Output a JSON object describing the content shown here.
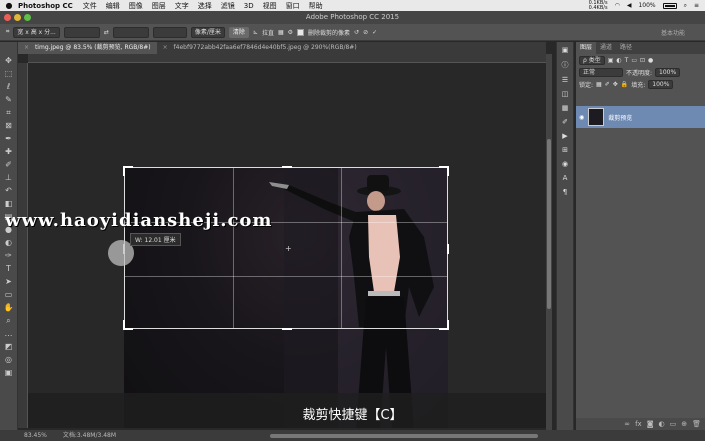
{
  "menubar": {
    "apple": "",
    "app_name": "Photoshop CC",
    "items": [
      "文件",
      "编辑",
      "图像",
      "图层",
      "文字",
      "选择",
      "滤镜",
      "3D",
      "视图",
      "窗口",
      "帮助"
    ],
    "net_up": "0.1KB/s",
    "net_down": "0.4KB/s",
    "battery": "100%"
  },
  "window": {
    "title": "Adobe Photoshop CC 2015"
  },
  "options": {
    "ratio": "宽 x 高 x 分...",
    "resolution_unit": "像素/厘米",
    "clear": "清除",
    "straighten": "拉直",
    "delete_cropped": "删除裁剪的像素",
    "workspace": "基本功能"
  },
  "tabs": [
    {
      "label": "timg.jpeg @ 83.5% (裁剪预览, RGB/8#)",
      "close": "×",
      "active": true
    },
    {
      "label": "f4ebf9772abb42faa6ef7846d4e40bf5.jpeg @ 290%(RGB/8#)",
      "close": "×",
      "active": false
    }
  ],
  "canvas": {
    "hint": "W: 12.01 厘米",
    "watermark": "www.haoyidiansheji.com",
    "subtitle": "裁剪快捷键【C】"
  },
  "status": {
    "zoom": "83.45%",
    "doc": "文档:3.48M/3.48M"
  },
  "panel": {
    "tabs": [
      "图层",
      "通道",
      "路径"
    ],
    "kind": "ρ 类型",
    "blend_mode": "正常",
    "opacity_label": "不透明度:",
    "opacity": "100%",
    "lock_label": "锁定:",
    "fill_label": "填充:",
    "fill": "100%",
    "layer_name": "裁剪预览"
  },
  "colors": {
    "accent_layer": "#6e89b2",
    "app_bg": "#282828"
  }
}
